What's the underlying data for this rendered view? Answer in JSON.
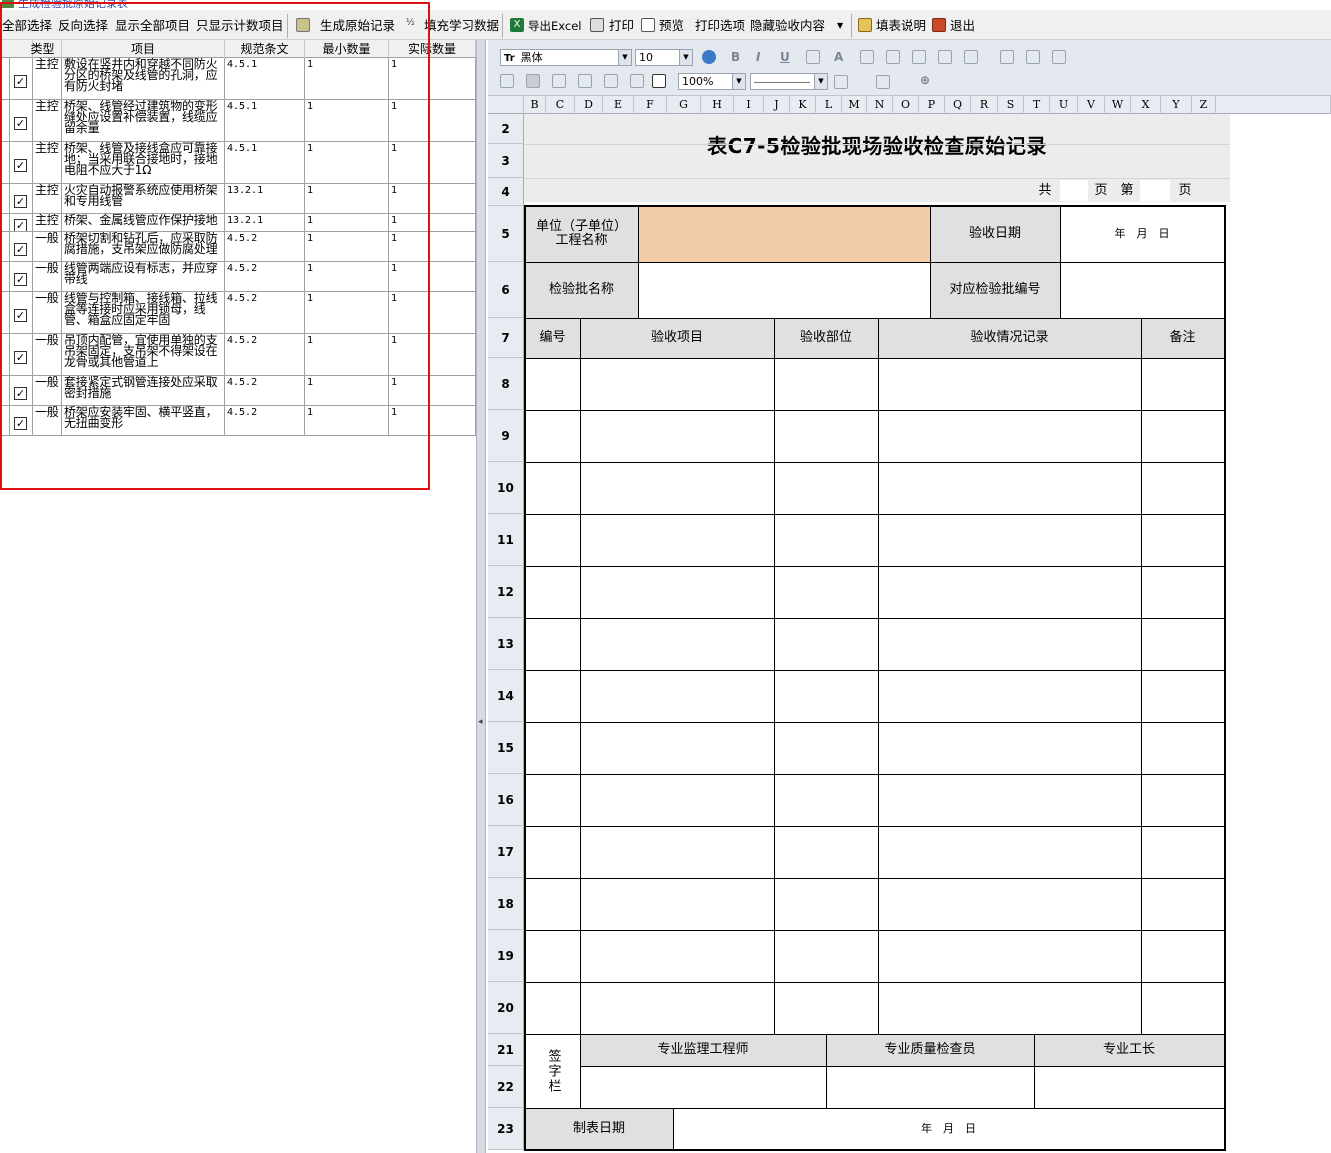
{
  "window": {
    "title": "生成检验批原始记录表"
  },
  "toolbar": {
    "select_all": "全部选择",
    "invert_select": "反向选择",
    "show_all": "显示全部项目",
    "show_counted": "只显示计数项目",
    "generate_record": "生成原始记录",
    "fill_learned": "填充学习数据",
    "export_excel": "导出Excel",
    "print": "打印",
    "preview": "预览",
    "print_options": "打印选项",
    "hide_content": "隐藏验收内容",
    "fill_help": "填表说明",
    "exit": "退出"
  },
  "items_grid": {
    "headers": [
      "类型",
      "项目",
      "规范条文",
      "最小数量",
      "实际数量"
    ],
    "rows": [
      {
        "checked": true,
        "type": "主控",
        "item": "敷设在竖井内和穿越不同防火分区的桥架及线管的孔洞，应有防火封堵",
        "clause": "4.5.1",
        "min": "1",
        "actual": "1"
      },
      {
        "checked": true,
        "type": "主控",
        "item": "桥架、线管经过建筑物的变形缝处应设置补偿装置，线缆应留余量",
        "clause": "4.5.1",
        "min": "1",
        "actual": "1"
      },
      {
        "checked": true,
        "type": "主控",
        "item": "桥架、线管及接线盒应可靠接地；当采用联合接地时，接地电阻不应大于1Ω",
        "clause": "4.5.1",
        "min": "1",
        "actual": "1"
      },
      {
        "checked": true,
        "type": "主控",
        "item": "火灾自动报警系统应使用桥架和专用线管",
        "clause": "13.2.1",
        "min": "1",
        "actual": "1"
      },
      {
        "checked": true,
        "type": "主控",
        "item": "桥架、金属线管应作保护接地",
        "clause": "13.2.1",
        "min": "1",
        "actual": "1"
      },
      {
        "checked": true,
        "type": "一般",
        "item": "桥架切割和钻孔后，应采取防腐措施，支吊架应做防腐处理",
        "clause": "4.5.2",
        "min": "1",
        "actual": "1"
      },
      {
        "checked": true,
        "type": "一般",
        "item": "线管两端应设有标志，并应穿带线",
        "clause": "4.5.2",
        "min": "1",
        "actual": "1"
      },
      {
        "checked": true,
        "type": "一般",
        "item": "线管与控制箱、接线箱、拉线盒等连接时应采用锁母，线管、箱盒应固定牢固",
        "clause": "4.5.2",
        "min": "1",
        "actual": "1"
      },
      {
        "checked": true,
        "type": "一般",
        "item": "吊顶内配管，宜使用单独的支吊架固定，支吊架不得架设在龙骨或其他管道上",
        "clause": "4.5.2",
        "min": "1",
        "actual": "1"
      },
      {
        "checked": true,
        "type": "一般",
        "item": "套接紧定式钢管连接处应采取密封措施",
        "clause": "4.5.2",
        "min": "1",
        "actual": "1"
      },
      {
        "checked": true,
        "type": "一般",
        "item": "桥架应安装牢固、横平竖直，无扭曲变形",
        "clause": "4.5.2",
        "min": "1",
        "actual": "1"
      }
    ]
  },
  "format_bar": {
    "font_name": "黑体",
    "font_size": "10",
    "zoom": "100%",
    "bold": "B",
    "italic": "I",
    "underline": "U",
    "font_color": "A"
  },
  "sheet": {
    "columns": [
      "B",
      "C",
      "D",
      "E",
      "F",
      "G",
      "H",
      "I",
      "J",
      "K",
      "L",
      "M",
      "N",
      "O",
      "P",
      "Q",
      "R",
      "S",
      "T",
      "U",
      "V",
      "W",
      "X",
      "Y",
      "Z"
    ],
    "row_numbers": [
      "2",
      "3",
      "4",
      "5",
      "6",
      "7",
      "8",
      "9",
      "10",
      "11",
      "12",
      "13",
      "14",
      "15",
      "16",
      "17",
      "18",
      "19",
      "20",
      "21",
      "22",
      "23"
    ],
    "title": "表C7-5检验批现场验收检查原始记录",
    "page_total_label": "共",
    "page_unit": "页",
    "page_current_label": "第",
    "page_unit2": "页",
    "unit_name_label": "单位（子单位）\n工程名称",
    "accept_date_label": "验收日期",
    "date_value": "年　月　日",
    "batch_name_label": "检验批名称",
    "batch_no_label": "对应检验批编号",
    "headers": [
      "编号",
      "验收项目",
      "验收部位",
      "验收情况记录",
      "备注"
    ],
    "sign_label": "签字栏",
    "sign_roles": [
      "专业监理工程师",
      "专业质量检查员",
      "专业工长"
    ],
    "made_date_label": "制表日期",
    "made_date_value": "年　月　日"
  },
  "colors": {
    "highlight_cell": "#f2cba8",
    "header_gray": "#e0e0e0",
    "red_frame": "#e01010"
  }
}
